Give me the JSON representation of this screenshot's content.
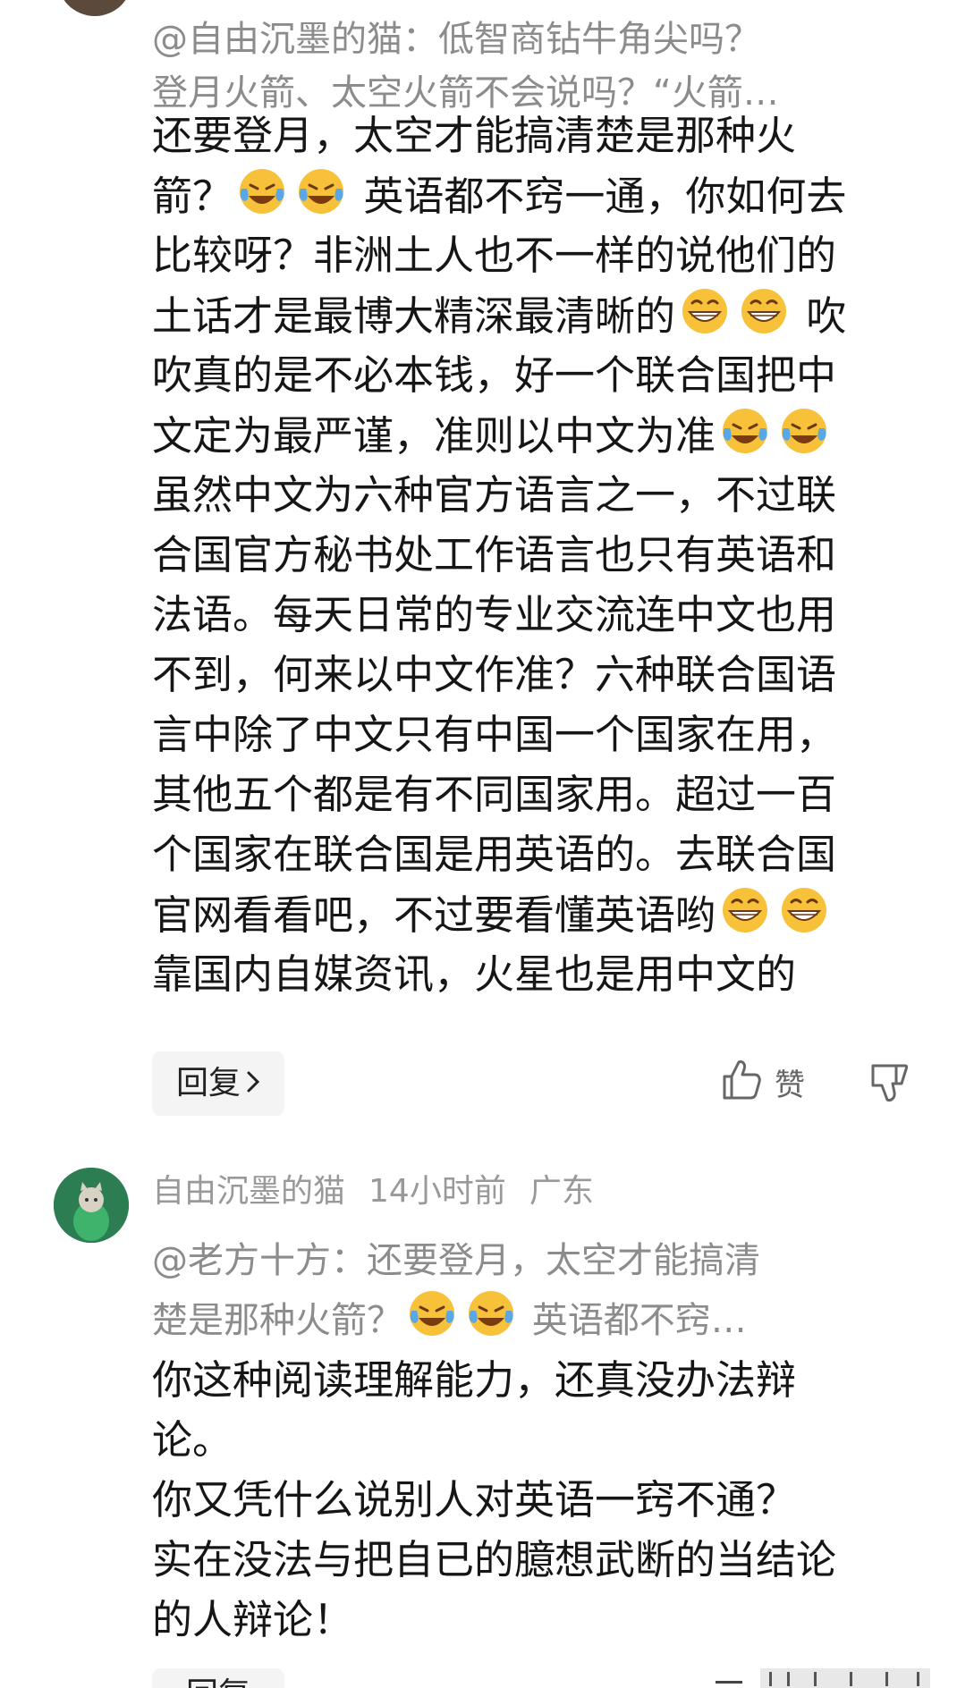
{
  "comment1": {
    "quote_lines": [
      "@自由沉墨的猫：低智商钻牛角尖吗？",
      "登月火箭、太空火箭不会说吗？“火箭…"
    ],
    "body_lines": [
      [
        "还要登月，太空才能搞清楚是那种火"
      ],
      [
        "箭？",
        "[laugh]",
        "[laugh]",
        " 英语都不窍一通，你如何去"
      ],
      [
        "比较呀？非洲土人也不一样的说他们的"
      ],
      [
        "土话才是最博大精深最清晰的",
        "[grin]",
        "[grin]",
        " 吹"
      ],
      [
        "吹真的是不必本钱，好一个联合国把中"
      ],
      [
        "文定为最严谨，准则以中文为准",
        "[laugh]",
        "[laugh]"
      ],
      [
        "虽然中文为六种官方语言之一，不过联"
      ],
      [
        "合国官方秘书处工作语言也只有英语和"
      ],
      [
        "法语。每天日常的专业交流连中文也用"
      ],
      [
        "不到，何来以中文作准？六种联合国语"
      ],
      [
        "言中除了中文只有中国一个国家在用，"
      ],
      [
        "其他五个都是有不同国家用。超过一百"
      ],
      [
        "个国家在联合国是用英语的。去联合国"
      ],
      [
        "官网看看吧，不过要看懂英语哟",
        "[grin]",
        "[grin]"
      ],
      [
        "靠国内自媒资讯，火星也是用中文的"
      ]
    ],
    "reply_label": "回复",
    "like_label": "赞"
  },
  "comment2": {
    "author": "自由沉墨的猫",
    "time": "14小时前",
    "location": "广东",
    "quote_lines": [
      [
        "@老方十方：还要登月，太空才能搞清"
      ],
      [
        "楚是那种火箭？",
        "[laugh]",
        "[laugh]",
        " 英语都不窍…"
      ]
    ],
    "body_lines": [
      "你这种阅读理解能力，还真没办法辩",
      "论。",
      "你又凭什么说别人对英语一窍不通？",
      "实在没法与把自已的臆想武断的当结论",
      "的人辩论！"
    ],
    "reply_label": "回复"
  },
  "icons": {
    "reply_chevron": "chevron-right-icon",
    "like": "thumbs-up-icon",
    "dislike": "thumbs-down-icon",
    "laugh_emoji": "laughing-crying-emoji",
    "grin_emoji": "grinning-emoji"
  }
}
